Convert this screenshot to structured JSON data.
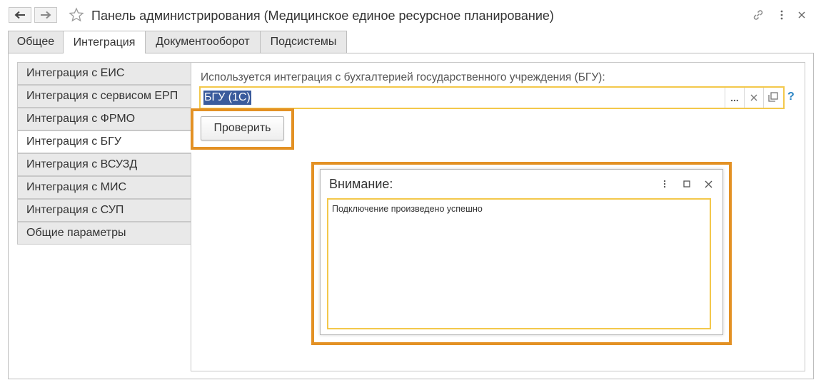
{
  "window": {
    "title": "Панель администрирования (Медицинское единое ресурсное планирование)",
    "icons": [
      "back-arrow-icon",
      "forward-arrow-icon",
      "star-icon",
      "link-icon",
      "more-vertical-icon",
      "close-icon"
    ]
  },
  "tabs": [
    {
      "label": "Общее",
      "active": false
    },
    {
      "label": "Интеграция",
      "active": true
    },
    {
      "label": "Документооборот",
      "active": false
    },
    {
      "label": "Подсистемы",
      "active": false
    }
  ],
  "sidebar": {
    "items": [
      {
        "label": "Интеграция с ЕИС",
        "active": false
      },
      {
        "label": "Интеграция с сервисом ЕРП",
        "active": false
      },
      {
        "label": "Интеграция с ФРМО",
        "active": false
      },
      {
        "label": "Интеграция с БГУ",
        "active": true
      },
      {
        "label": "Интеграция с ВСУЗД",
        "active": false
      },
      {
        "label": "Интеграция с МИС",
        "active": false
      },
      {
        "label": "Интеграция с СУП",
        "active": false
      },
      {
        "label": "Общие параметры",
        "active": false
      }
    ]
  },
  "integration": {
    "field_label": "Используется интеграция с бухгалтерией государственного учреждения (БГУ):",
    "field_value": "БГУ (1С)",
    "select_btn": "...",
    "clear_btn": "×",
    "help": "?",
    "check_button": "Проверить"
  },
  "dialog": {
    "title": "Внимание:",
    "message": "Подключение произведено успешно"
  },
  "colors": {
    "highlight": "#e39124",
    "field_border": "#f3c84b",
    "selection": "#3a5b9c",
    "help": "#2a84c4"
  }
}
